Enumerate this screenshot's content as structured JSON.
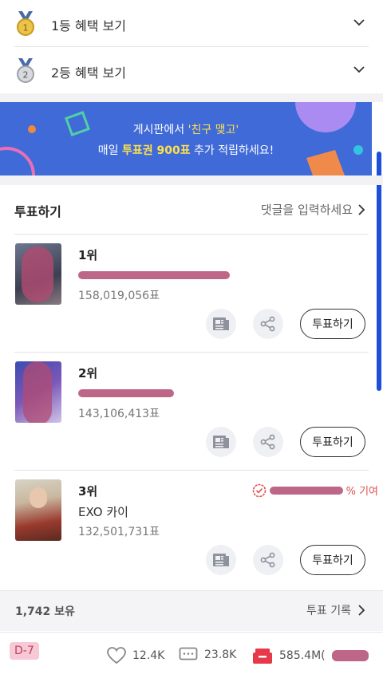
{
  "benefits": [
    {
      "medal": "gold-medal-icon",
      "medal_number": "1",
      "label": "1등 혜택 보기"
    },
    {
      "medal": "silver-medal-icon",
      "medal_number": "2",
      "label": "2등 혜택 보기"
    }
  ],
  "banner": {
    "line1_pre": "게시판에서 ",
    "line1_quote": "'친구 맺고'",
    "line2_pre": "매일 ",
    "line2_highlight": "투표권 900표",
    "line2_post": " 추가 적립하세요!"
  },
  "vote_section": {
    "title": "투표하기",
    "comment_link": "댓글을 입력하세요"
  },
  "ranking": [
    {
      "rank": "1위",
      "name": "",
      "votes": "158,019,056표",
      "vote_label": "투표하기"
    },
    {
      "rank": "2위",
      "name": "",
      "votes": "143,106,413표",
      "vote_label": "투표하기"
    },
    {
      "rank": "3위",
      "name": "EXO 카이",
      "votes": "132,501,731표",
      "vote_label": "투표하기",
      "contribution_suffix": "% 기여"
    }
  ],
  "footer": {
    "owned": "1,742 보유",
    "history": "투표 기록",
    "dday": "D-7",
    "likes": "12.4K",
    "comments": "23.8K",
    "total_votes": "585.4M("
  },
  "colors": {
    "banner_bg": "#3f6ad8",
    "highlight": "#ffe14d",
    "scribble": "#b24b72",
    "contribution": "#e05050",
    "vote_box_icon": "#e6394a"
  }
}
